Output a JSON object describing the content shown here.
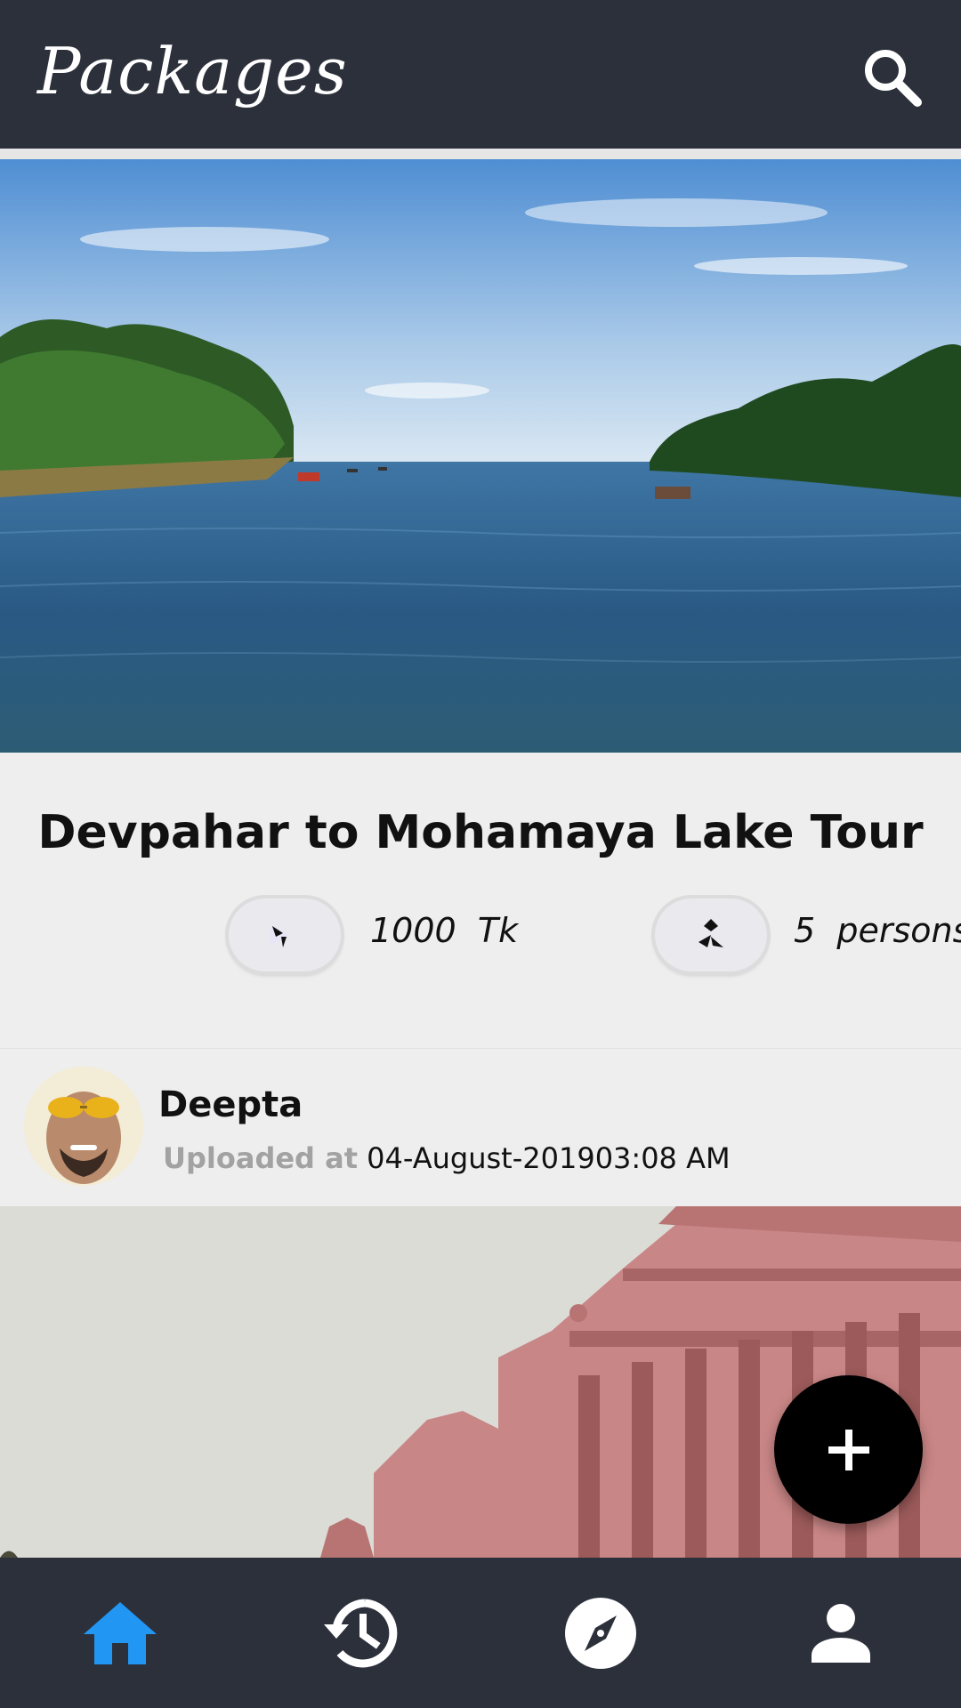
{
  "appbar": {
    "title": "Packages",
    "search_icon": "search-icon"
  },
  "packages": [
    {
      "image": "lake-landscape-photo",
      "title": "Devpahar to Mohamaya Lake Tour",
      "price": {
        "icon": "money-icon",
        "value": "1000",
        "unit": "Tk"
      },
      "capacity": {
        "icon": "persons-icon",
        "value": "5",
        "unit": "persons"
      }
    }
  ],
  "posts": [
    {
      "user_name": "Deepta",
      "uploaded_label": "Uploaded at",
      "uploaded_value": "04-August-201903:08 AM",
      "image": "pink-palace-photo"
    }
  ],
  "fab": {
    "icon": "plus-icon"
  },
  "bottom_nav": {
    "active_color": "#2196f3",
    "items": [
      {
        "icon": "home-icon",
        "active": true
      },
      {
        "icon": "history-icon",
        "active": false
      },
      {
        "icon": "explore-compass-icon",
        "active": false
      },
      {
        "icon": "profile-icon",
        "active": false
      }
    ]
  },
  "colors": {
    "bars": "#2c303b",
    "background": "#eeeeee",
    "fab": "#000000"
  }
}
